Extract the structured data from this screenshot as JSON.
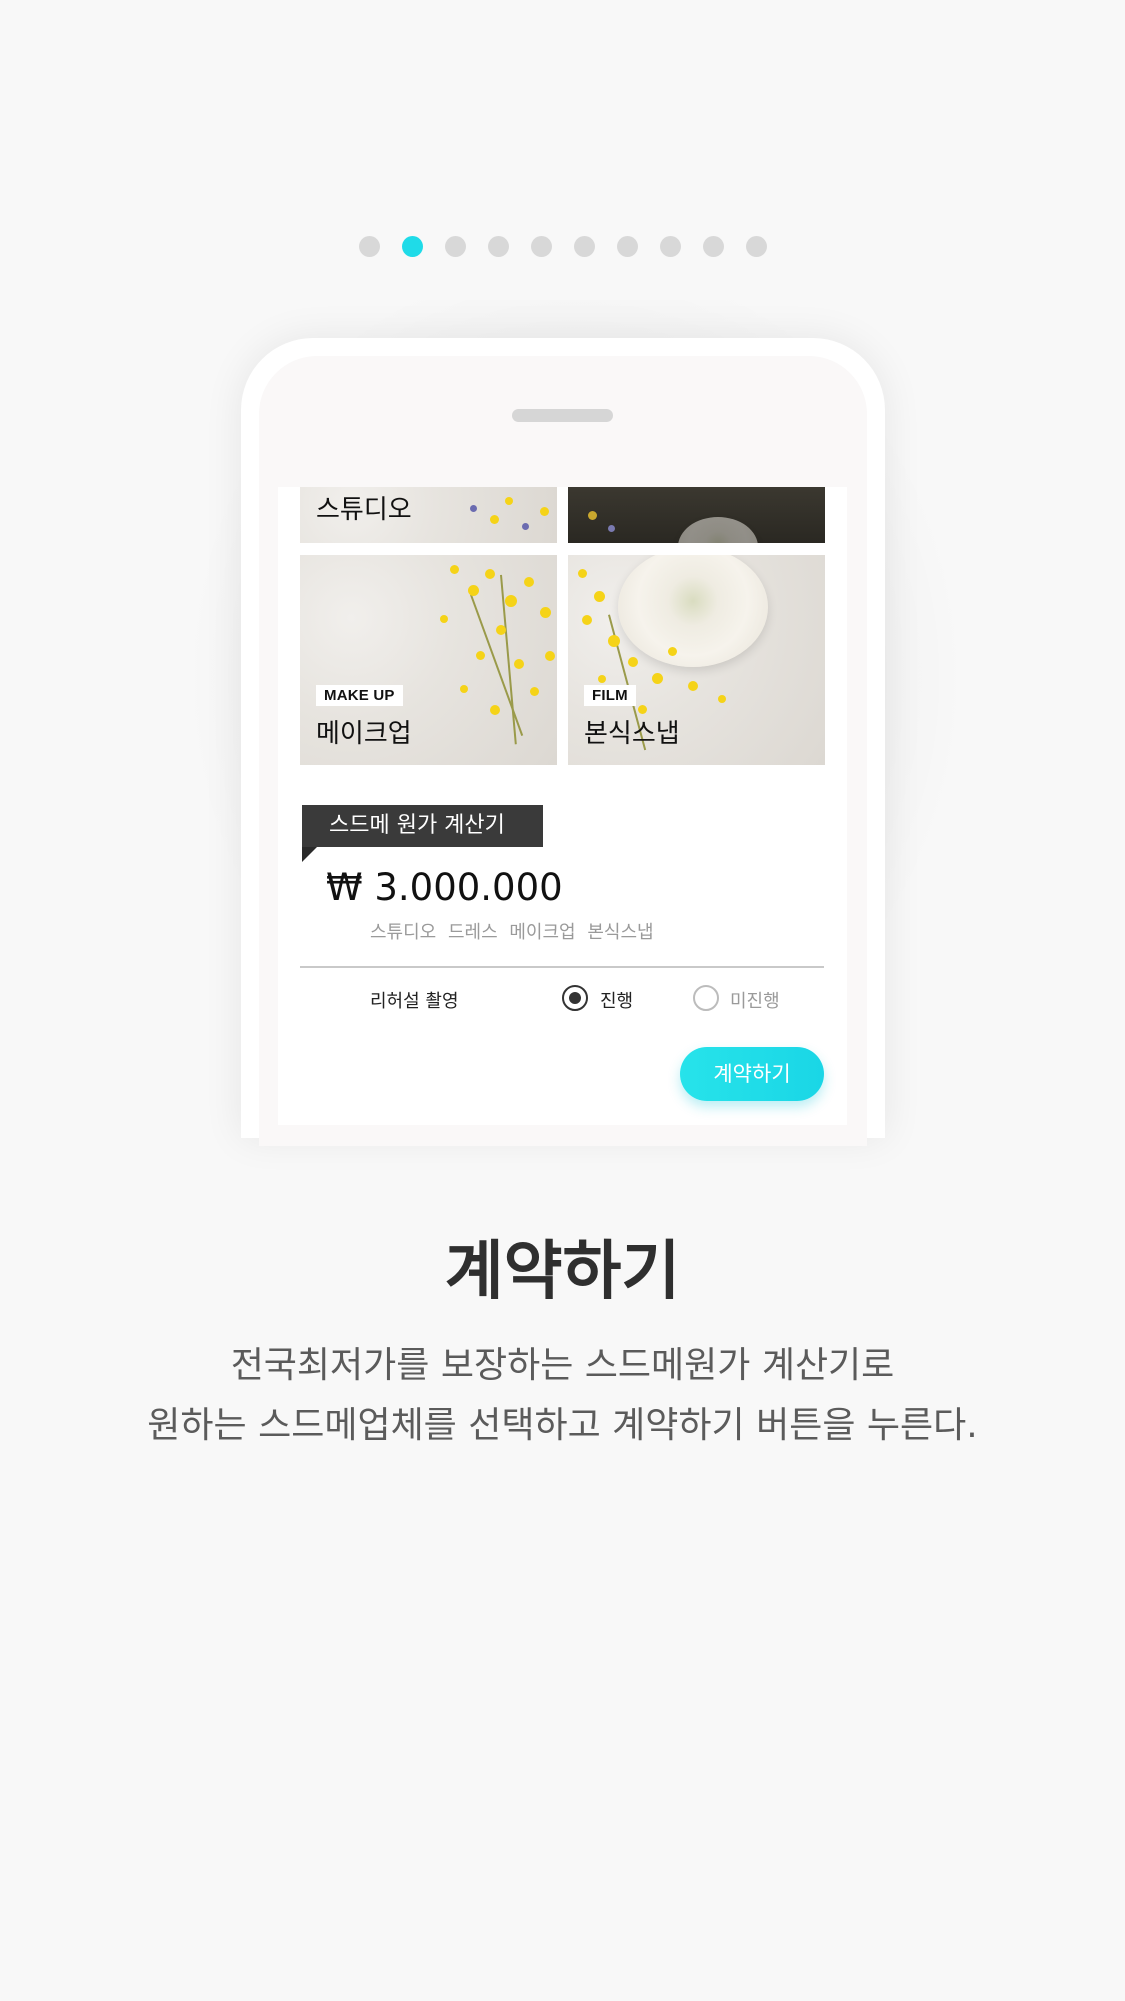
{
  "pager": {
    "total": 10,
    "active_index": 1,
    "active_color": "#1fdbe8"
  },
  "phone": {
    "tiles": [
      {
        "tag": "",
        "title": "스튜디오"
      },
      {
        "tag": "",
        "title": ""
      },
      {
        "tag": "MAKE UP",
        "title": "메이크업"
      },
      {
        "tag": "FILM",
        "title": "본식스냅"
      }
    ],
    "calculator": {
      "title": "스드메 원가 계산기",
      "price": "₩ 3.000.000",
      "items": "스튜디오 드레스 메이크업 본식스냅"
    },
    "rehearsal": {
      "label": "리허설 촬영",
      "option_yes": "진행",
      "option_no": "미진행",
      "selected": "진행"
    },
    "contract_button": "계약하기",
    "accent_color": "#1fdbe8"
  },
  "copy": {
    "headline": "계약하기",
    "line1": "전국최저가를 보장하는 스드메원가 계산기로",
    "line2": "원하는 스드메업체를 선택하고 계약하기 버튼을 누른다."
  }
}
